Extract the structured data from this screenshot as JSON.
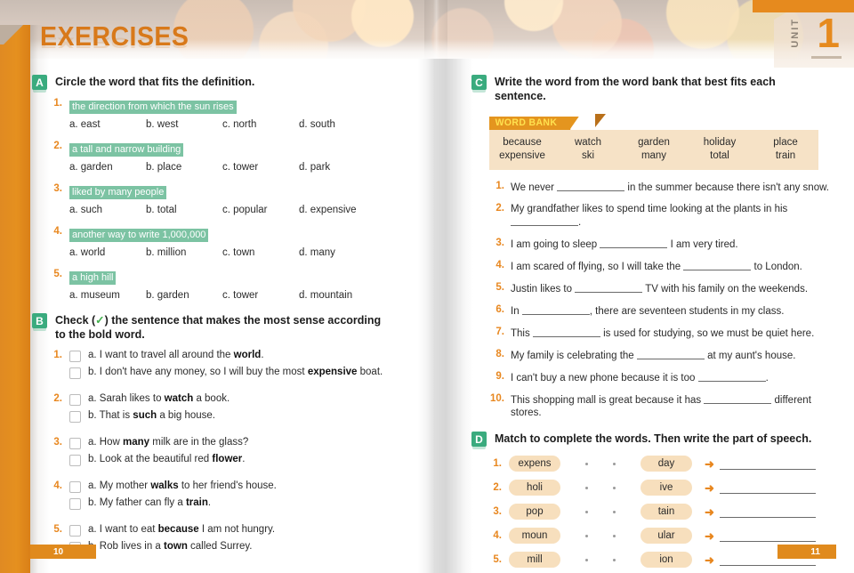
{
  "header": {
    "title": "EXERCISES",
    "unit_label": "UNIT",
    "unit_number": "1"
  },
  "footer": {
    "page_left": "10",
    "page_right": "11"
  },
  "sections": {
    "a": {
      "badge": "A",
      "title": "Circle the word that fits the definition.",
      "items": [
        {
          "num": "1.",
          "definition": "the direction from which the sun rises",
          "options": [
            "a. east",
            "b. west",
            "c. north",
            "d. south"
          ]
        },
        {
          "num": "2.",
          "definition": "a tall and narrow building",
          "options": [
            "a. garden",
            "b. place",
            "c. tower",
            "d. park"
          ]
        },
        {
          "num": "3.",
          "definition": "liked by many people",
          "options": [
            "a. such",
            "b. total",
            "c. popular",
            "d. expensive"
          ]
        },
        {
          "num": "4.",
          "definition": "another way to write 1,000,000",
          "options": [
            "a. world",
            "b. million",
            "c. town",
            "d. many"
          ]
        },
        {
          "num": "5.",
          "definition": "a high hill",
          "options": [
            "a. museum",
            "b. garden",
            "c. tower",
            "d. mountain"
          ]
        }
      ]
    },
    "b": {
      "badge": "B",
      "title_before": "Check (",
      "tick": "✓",
      "title_after": ") the sentence that makes the most sense according to the bold word.",
      "items": [
        {
          "num": "1.",
          "a_pre": "a. I want to travel all around the ",
          "a_bold": "world",
          "a_post": ".",
          "b_pre": "b. I don't have any money, so I will buy the most ",
          "b_bold": "expensive",
          "b_post": " boat."
        },
        {
          "num": "2.",
          "a_pre": "a. Sarah likes to ",
          "a_bold": "watch",
          "a_post": " a book.",
          "b_pre": "b. That is ",
          "b_bold": "such",
          "b_post": " a big house."
        },
        {
          "num": "3.",
          "a_pre": "a. How ",
          "a_bold": "many",
          "a_post": " milk are in the glass?",
          "b_pre": "b. Look at the beautiful red ",
          "b_bold": "flower",
          "b_post": "."
        },
        {
          "num": "4.",
          "a_pre": "a. My mother ",
          "a_bold": "walks",
          "a_post": " to her friend's house.",
          "b_pre": "b. My father can fly a ",
          "b_bold": "train",
          "b_post": "."
        },
        {
          "num": "5.",
          "a_pre": "a. I want to eat ",
          "a_bold": "because",
          "a_post": " I am not hungry.",
          "b_pre": "b. Rob lives in a ",
          "b_bold": "town",
          "b_post": " called Surrey."
        }
      ]
    },
    "c": {
      "badge": "C",
      "title": "Write the word from the word bank that best fits each sentence.",
      "word_bank_label": "WORD BANK",
      "word_bank": [
        {
          "top": "because",
          "bottom": "expensive"
        },
        {
          "top": "watch",
          "bottom": "ski"
        },
        {
          "top": "garden",
          "bottom": "many"
        },
        {
          "top": "holiday",
          "bottom": "total"
        },
        {
          "top": "place",
          "bottom": "train"
        }
      ],
      "items": [
        {
          "num": "1.",
          "pre": "We never ",
          "post": " in the summer because there isn't any snow."
        },
        {
          "num": "2.",
          "pre": "My grandfather likes to spend time looking at the plants in his ",
          "post": "."
        },
        {
          "num": "3.",
          "pre": "I am going to sleep ",
          "post": " I am very tired."
        },
        {
          "num": "4.",
          "pre": "I am scared of flying, so I will take the ",
          "post": " to London."
        },
        {
          "num": "5.",
          "pre": "Justin likes to ",
          "post": " TV with his family on the weekends."
        },
        {
          "num": "6.",
          "pre": "In ",
          "post": ", there are seventeen students in my class."
        },
        {
          "num": "7.",
          "pre": "This ",
          "post": " is used for studying, so we must be quiet here."
        },
        {
          "num": "8.",
          "pre": "My family is celebrating the ",
          "post": " at my aunt's house."
        },
        {
          "num": "9.",
          "pre": "I can't buy a new phone because it is too ",
          "post": "."
        },
        {
          "num": "10.",
          "pre": "This shopping mall is great because it has ",
          "post": " different stores."
        }
      ]
    },
    "d": {
      "badge": "D",
      "title": "Match to complete the words. Then write the part of speech.",
      "items": [
        {
          "num": "1.",
          "left": "expens",
          "right": "day"
        },
        {
          "num": "2.",
          "left": "holi",
          "right": "ive"
        },
        {
          "num": "3.",
          "left": "pop",
          "right": "tain"
        },
        {
          "num": "4.",
          "left": "moun",
          "right": "ular"
        },
        {
          "num": "5.",
          "left": "mill",
          "right": "ion"
        }
      ],
      "arrow": "➜"
    }
  },
  "colors": {
    "orange": "#e08a1d",
    "title_orange": "#d8791a",
    "badge_green": "#3aab7e",
    "highlight_green": "#7cc3a3",
    "wordbank_bg": "#f6e2c6",
    "pill_bg": "#f7dfbd"
  }
}
